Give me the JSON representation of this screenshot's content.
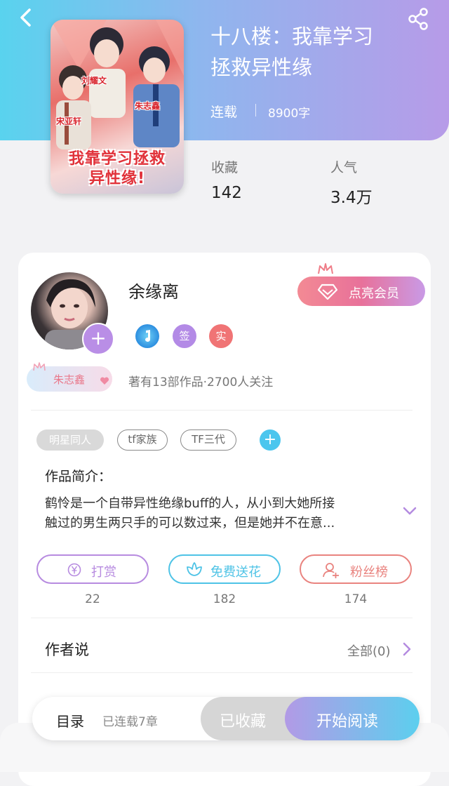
{
  "header": {
    "title_line1": "十八楼：我靠学习",
    "title_line2": "拯救异性缘",
    "status": "连载",
    "word_count": "8900字",
    "back_icon": "chevron-left-icon",
    "share_icon": "share-icon"
  },
  "cover": {
    "title_line1": "我靠学习拯救",
    "title_line2": "异性缘!",
    "names": [
      "刘耀文",
      "朱志鑫",
      "宋亚轩"
    ]
  },
  "stats": [
    {
      "label": "收藏",
      "value": "142"
    },
    {
      "label": "人气",
      "value": "3.4万"
    }
  ],
  "author": {
    "name": "余缘离",
    "vip_button": "点亮会员",
    "badges": [
      {
        "icon": "music-note-icon",
        "color": "#3aa7ea"
      },
      {
        "text": "签",
        "color": "#b38ae6"
      },
      {
        "text": "实",
        "color": "#f07475"
      }
    ],
    "fan_tag": "朱志鑫",
    "meta": "著有13部作品·2700人关注"
  },
  "tags": [
    "明星同人",
    "tf家族",
    "TF三代"
  ],
  "intro": {
    "heading": "作品简介：",
    "line1": "鹤怜是一个自带异性绝缘buff的人，从小到大她所接",
    "line2": "触过的男生两只手的可以数过来，但是她并不在意..."
  },
  "actions": [
    {
      "label": "打赏",
      "count": "22",
      "color": "#b78be0"
    },
    {
      "label": "免费送花",
      "count": "182",
      "color": "#4ec3e6"
    },
    {
      "label": "粉丝榜",
      "count": "174",
      "color": "#e9837f"
    }
  ],
  "author_says": {
    "heading": "作者说",
    "all_label": "全部(0)"
  },
  "bottom_bar": {
    "toc_label": "目录",
    "progress": "已连载7章",
    "collected_label": "已收藏",
    "read_label": "开始阅读"
  },
  "colors": {
    "header_gradient": [
      "#59d3ee",
      "#b79be8"
    ],
    "accent_blue": "#4cc6ee",
    "accent_purple": "#b98ee6"
  }
}
